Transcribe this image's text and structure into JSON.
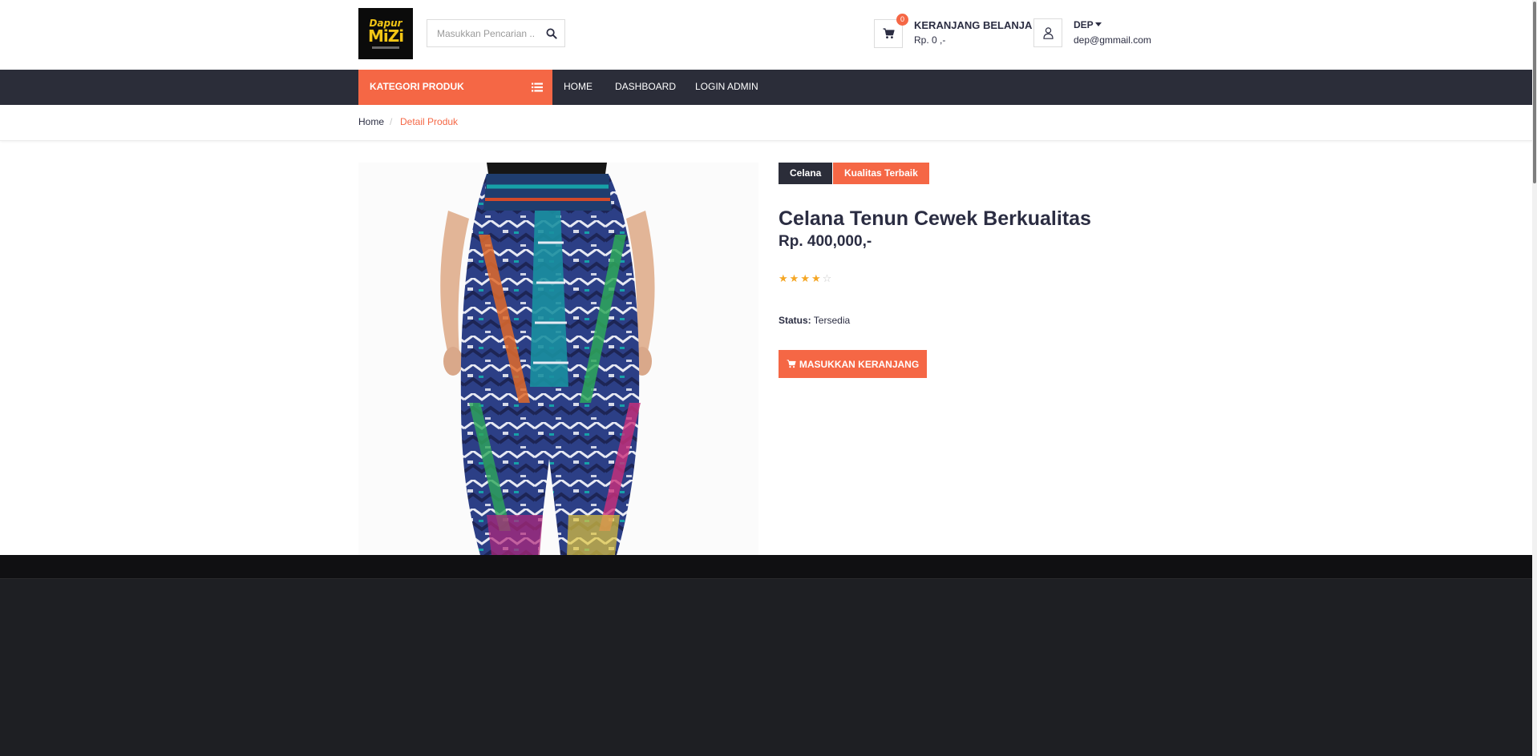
{
  "logo": {
    "line1": "Dapur",
    "line2": "MiZi"
  },
  "search": {
    "placeholder": "Masukkan Pencarian .."
  },
  "cart": {
    "count": "0",
    "title": "KERANJANG BELANJA :",
    "total": "Rp. 0 ,-"
  },
  "user": {
    "name": "DEP",
    "email": "dep@gmmail.com"
  },
  "nav": {
    "category_label": "KATEGORI PRODUK",
    "links": [
      "HOME",
      "DASHBOARD",
      "LOGIN ADMIN"
    ]
  },
  "breadcrumb": {
    "home": "Home",
    "separator": "/",
    "current": "Detail Produk"
  },
  "product": {
    "category_tag": "Celana",
    "quality_tag": "Kualitas Terbaik",
    "title": "Celana Tenun Cewek Berkualitas",
    "price": "Rp. 400,000,-",
    "rating": 4,
    "rating_max": 5,
    "status_label": "Status:",
    "status_value": "Tersedia",
    "add_to_cart_label": "MASUKKAN KERANJANG"
  },
  "colors": {
    "accent": "#f56745",
    "nav_bg": "#2b2d39",
    "text": "#2b2d42",
    "footer_bg": "#1e1f23",
    "star": "#f5a623"
  },
  "icons": [
    "search-icon",
    "cart-icon",
    "user-icon",
    "list-icon",
    "star-icon",
    "chevron-down-icon"
  ]
}
